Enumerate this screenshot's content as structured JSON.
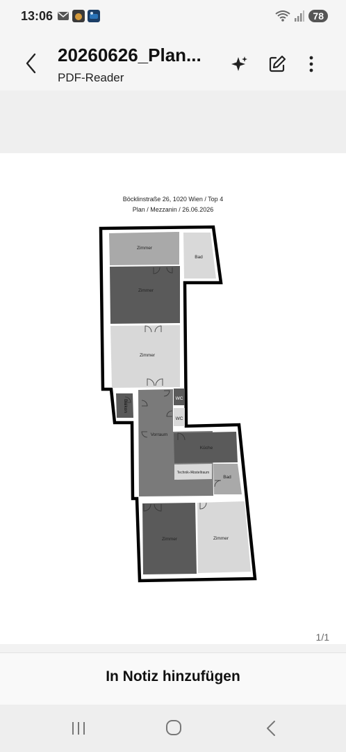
{
  "status": {
    "time": "13:06",
    "battery": "78",
    "colors": {
      "mail": "#555555",
      "app1": "#d59a3b",
      "app2": "#2a73b8"
    }
  },
  "header": {
    "title": "20260626_Plan...",
    "subtitle": "PDF-Reader"
  },
  "document": {
    "address_line": "Böcklinstraße 26, 1020 Wien / Top 4",
    "plan_line": "Plan / Mezzanin / 26.06.2026",
    "rooms": {
      "zimmer_top": "Zimmer",
      "bad_top": "Bad",
      "zimmer_dark": "Zimmer",
      "zimmer_mid": "Zimmer",
      "wc1": "WC",
      "wc2": "WC",
      "balkon": "Balkon",
      "vorraum": "Vorraum",
      "kueche": "Küche",
      "technik": "Technik-/Abstellraum",
      "bad_low": "Bad",
      "zimmer_bl": "Zimmer",
      "zimmer_br": "Zimmer"
    },
    "page_indicator": "1/1"
  },
  "actions": {
    "add_to_note": "In Notiz hinzufügen"
  }
}
